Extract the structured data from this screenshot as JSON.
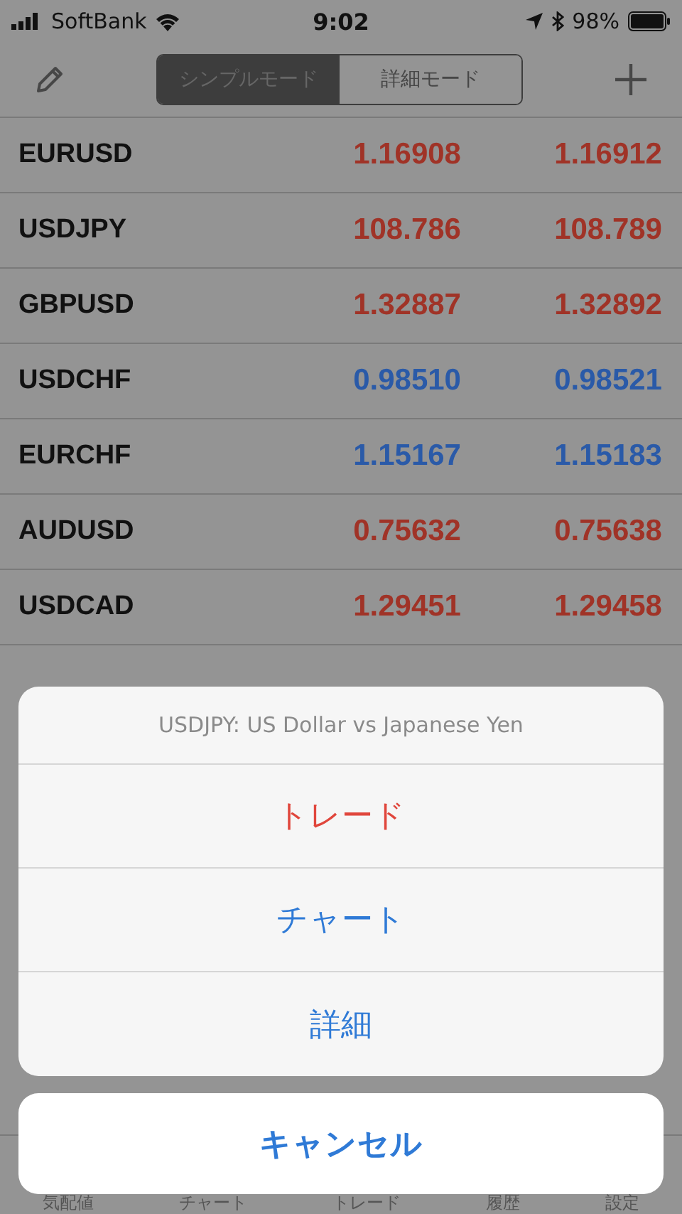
{
  "status_bar": {
    "carrier": "SoftBank",
    "time": "9:02",
    "battery": "98%"
  },
  "mode_tabs": [
    {
      "label": "シンプルモード",
      "selected": true
    },
    {
      "label": "詳細モード",
      "selected": false
    }
  ],
  "quotes": [
    {
      "symbol": "EURUSD",
      "bid": "1.16908",
      "ask": "1.16912",
      "color": "#a03327"
    },
    {
      "symbol": "USDJPY",
      "bid": "108.786",
      "ask": "108.789",
      "color": "#a03327"
    },
    {
      "symbol": "GBPUSD",
      "bid": "1.32887",
      "ask": "1.32892",
      "color": "#a03327"
    },
    {
      "symbol": "USDCHF",
      "bid": "0.98510",
      "ask": "0.98521",
      "color": "#2a5aa8"
    },
    {
      "symbol": "EURCHF",
      "bid": "1.15167",
      "ask": "1.15183",
      "color": "#2a5aa8"
    },
    {
      "symbol": "AUDUSD",
      "bid": "0.75632",
      "ask": "0.75638",
      "color": "#a03327"
    },
    {
      "symbol": "USDCAD",
      "bid": "1.29451",
      "ask": "1.29458",
      "color": "#a03327"
    }
  ],
  "tab_bar": [
    "気配値",
    "チャート",
    "トレード",
    "履歴",
    "設定"
  ],
  "action_sheet": {
    "title": "USDJPY: US Dollar vs Japanese Yen",
    "actions": [
      {
        "label": "トレード",
        "kind": "destructive"
      },
      {
        "label": "チャート",
        "kind": "default"
      },
      {
        "label": "詳細",
        "kind": "default"
      }
    ],
    "cancel": "キャンセル"
  }
}
